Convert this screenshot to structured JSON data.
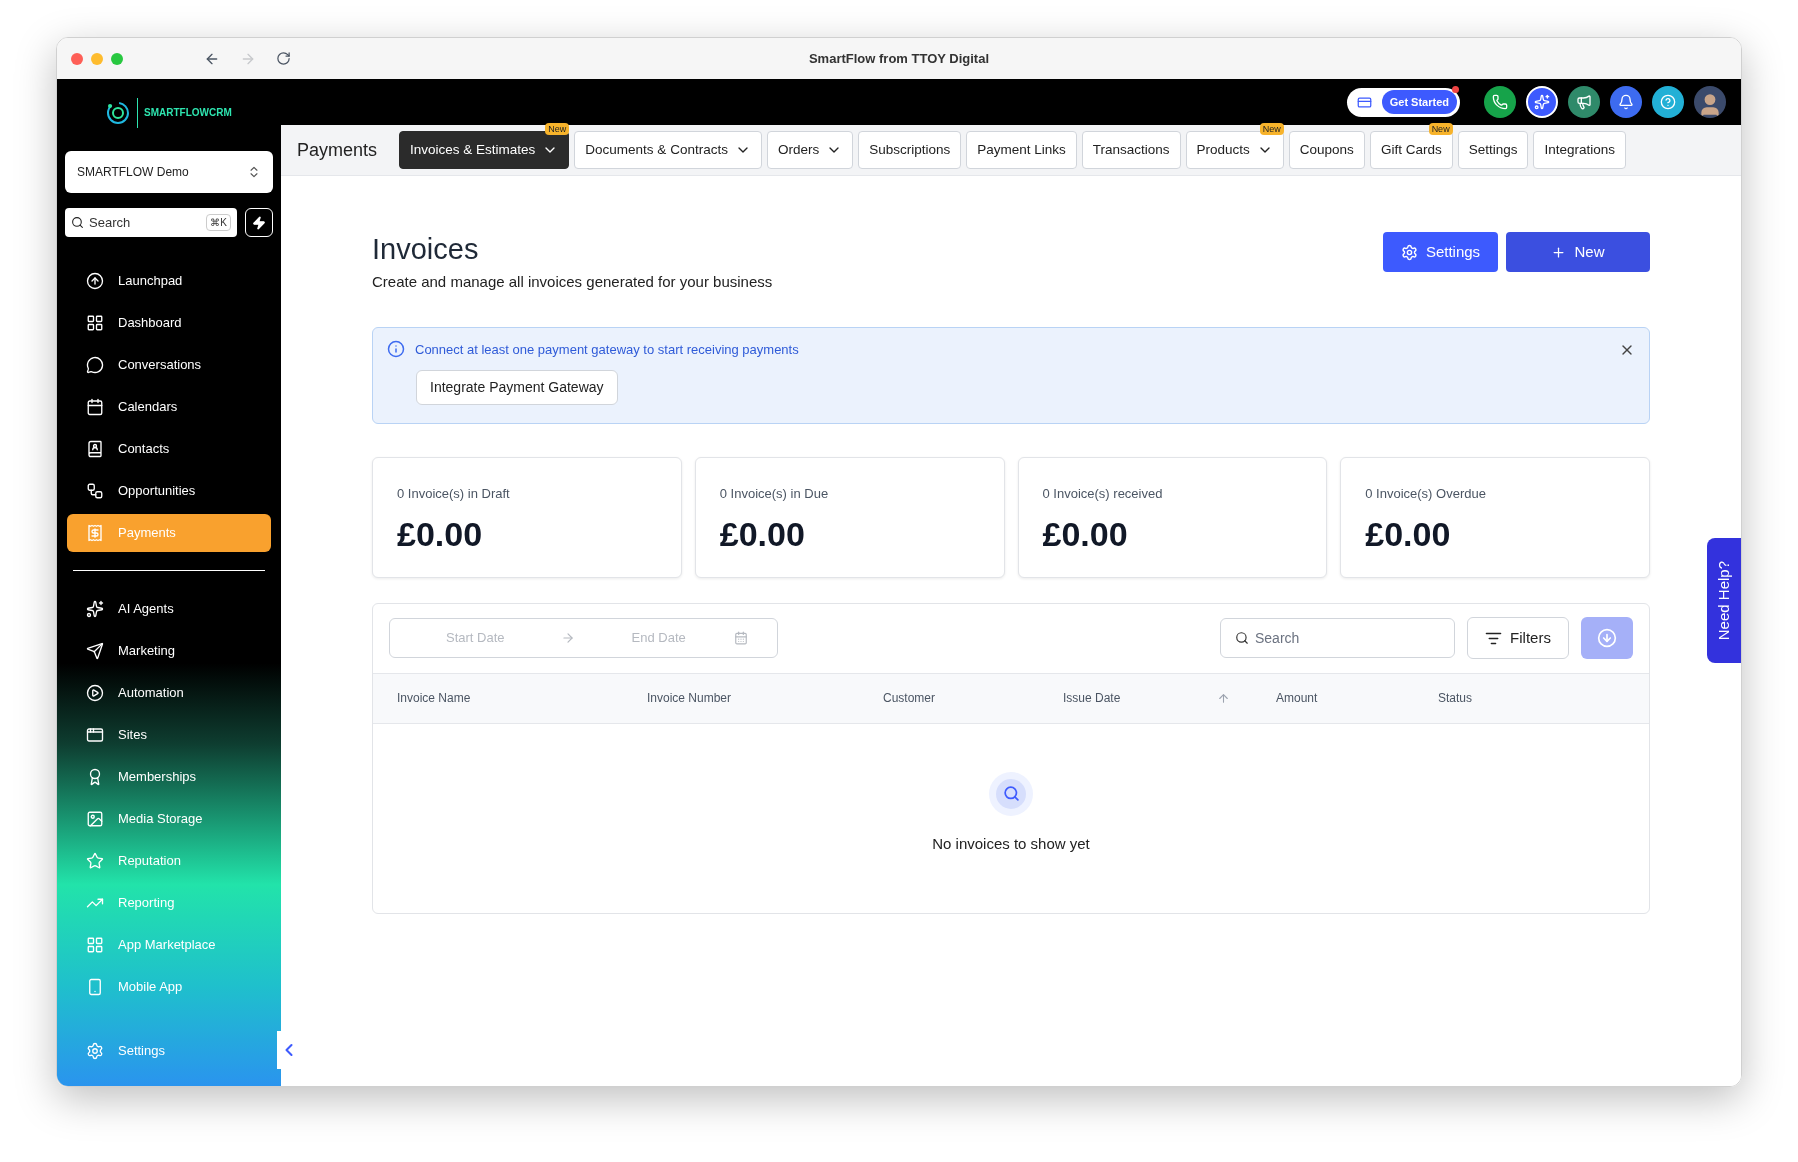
{
  "browser": {
    "title": "SmartFlow from TTOY Digital"
  },
  "brand": {
    "name": "SMARTFLOWCRM"
  },
  "account_switcher": {
    "value": "SMARTFLOW Demo"
  },
  "sidebar_search": {
    "placeholder": "Search",
    "shortcut": "⌘K"
  },
  "sidebar": {
    "primary": [
      {
        "label": "Launchpad",
        "selected": false
      },
      {
        "label": "Dashboard",
        "selected": false
      },
      {
        "label": "Conversations",
        "selected": false
      },
      {
        "label": "Calendars",
        "selected": false
      },
      {
        "label": "Contacts",
        "selected": false
      },
      {
        "label": "Opportunities",
        "selected": false
      },
      {
        "label": "Payments",
        "selected": true
      }
    ],
    "secondary": [
      {
        "label": "AI Agents",
        "selected": false
      },
      {
        "label": "Marketing",
        "selected": false
      },
      {
        "label": "Automation",
        "selected": false
      },
      {
        "label": "Sites",
        "selected": false
      },
      {
        "label": "Memberships",
        "selected": false
      },
      {
        "label": "Media Storage",
        "selected": false
      },
      {
        "label": "Reputation",
        "selected": false
      },
      {
        "label": "Reporting",
        "selected": false
      },
      {
        "label": "App Marketplace",
        "selected": false
      },
      {
        "label": "Mobile App",
        "selected": false
      }
    ],
    "footer": {
      "label": "Settings",
      "selected": false
    }
  },
  "topbar": {
    "get_started": "Get Started"
  },
  "module": {
    "title": "Payments"
  },
  "tabs": [
    {
      "label": "Invoices & Estimates",
      "selected": true,
      "dropdown": true,
      "badge": "New"
    },
    {
      "label": "Documents & Contracts",
      "selected": false,
      "dropdown": true
    },
    {
      "label": "Orders",
      "selected": false,
      "dropdown": true
    },
    {
      "label": "Subscriptions",
      "selected": false,
      "dropdown": false
    },
    {
      "label": "Payment Links",
      "selected": false,
      "dropdown": false
    },
    {
      "label": "Transactions",
      "selected": false,
      "dropdown": false
    },
    {
      "label": "Products",
      "selected": false,
      "dropdown": true,
      "badge": "New"
    },
    {
      "label": "Coupons",
      "selected": false,
      "dropdown": false
    },
    {
      "label": "Gift Cards",
      "selected": false,
      "dropdown": false,
      "badge": "New"
    },
    {
      "label": "Settings",
      "selected": false,
      "dropdown": false
    },
    {
      "label": "Integrations",
      "selected": false,
      "dropdown": false
    }
  ],
  "page": {
    "title": "Invoices",
    "subtitle": "Create and manage all invoices generated for your business",
    "actions": [
      {
        "label": "Settings",
        "kind": "settings"
      },
      {
        "label": "New",
        "kind": "new"
      }
    ]
  },
  "alert": {
    "message": "Connect at least one payment gateway to start receiving payments",
    "action": "Integrate Payment Gateway"
  },
  "stats": [
    {
      "label": "0 Invoice(s) in Draft",
      "amount": "£0.00"
    },
    {
      "label": "0 Invoice(s) in Due",
      "amount": "£0.00"
    },
    {
      "label": "0 Invoice(s) received",
      "amount": "£0.00"
    },
    {
      "label": "0 Invoice(s) Overdue",
      "amount": "£0.00"
    }
  ],
  "filters": {
    "start_placeholder": "Start Date",
    "end_placeholder": "End Date",
    "search_placeholder": "Search",
    "filters_label": "Filters"
  },
  "table": {
    "columns": [
      {
        "label": "Invoice Name"
      },
      {
        "label": "Invoice Number"
      },
      {
        "label": "Customer"
      },
      {
        "label": "Issue Date",
        "sorted": true
      },
      {
        "label": "Amount"
      },
      {
        "label": "Status"
      }
    ],
    "empty_message": "No invoices to show yet"
  },
  "help_tab": {
    "label": "Need Help?"
  }
}
